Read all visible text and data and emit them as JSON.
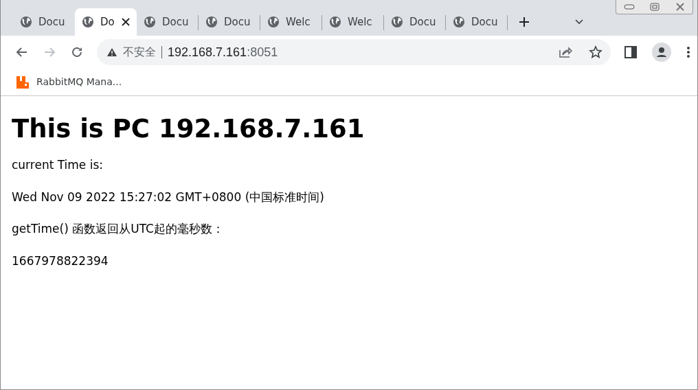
{
  "tabs": [
    {
      "title": "Docu",
      "selected": false
    },
    {
      "title": "Do",
      "selected": true
    },
    {
      "title": "Docu",
      "selected": false
    },
    {
      "title": "Docu",
      "selected": false
    },
    {
      "title": "Welc",
      "selected": false
    },
    {
      "title": "Welc",
      "selected": false
    },
    {
      "title": "Docu",
      "selected": false
    },
    {
      "title": "Docu",
      "selected": false
    }
  ],
  "nav_buttons": [
    {
      "kind": "back",
      "disabled": false
    },
    {
      "kind": "forward",
      "disabled": true
    },
    {
      "kind": "reload",
      "disabled": false
    }
  ],
  "address": {
    "security_label": "不安全",
    "host": "192.168.7.161",
    "port": ":8051"
  },
  "bookmarks": [
    {
      "title": "RabbitMQ Mana..."
    }
  ],
  "page": {
    "heading": "This is PC 192.168.7.161",
    "paragraphs": [
      "current Time is:",
      "Wed Nov 09 2022 15:27:02 GMT+0800 (中国标准时间)",
      "getTime() 函数返回从UTC起的毫秒数：",
      "1667978822394"
    ]
  }
}
